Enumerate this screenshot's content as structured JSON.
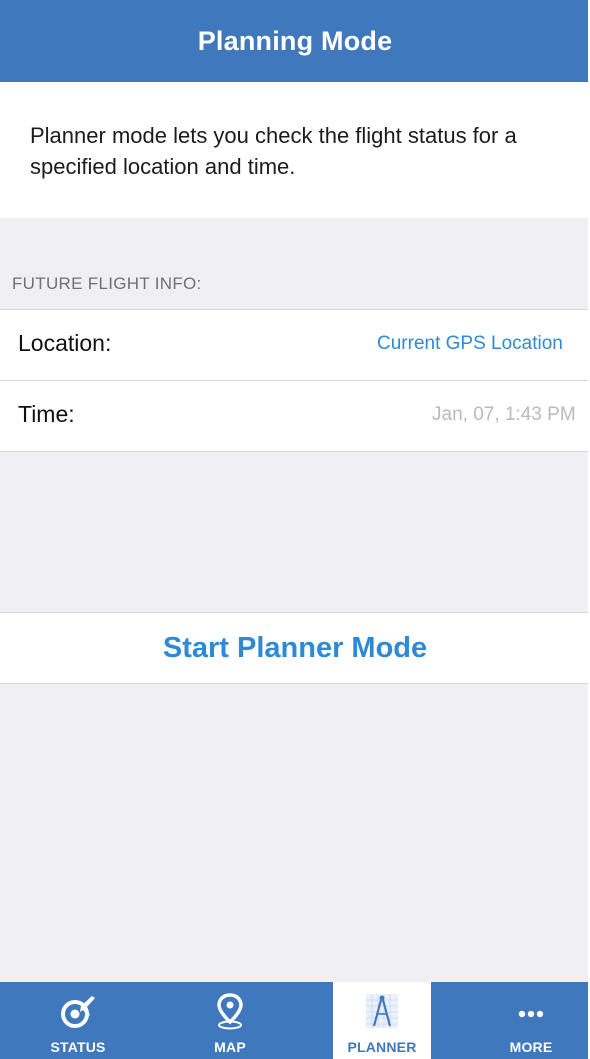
{
  "header": {
    "title": "Planning Mode"
  },
  "intro": {
    "text": "Planner mode lets you check the flight status for a specified location and time."
  },
  "future_flight": {
    "section_label": "FUTURE FLIGHT INFO:",
    "location": {
      "label": "Location:",
      "value": "Current GPS Location"
    },
    "time": {
      "label": "Time:",
      "value": "Jan, 07, 1:43 PM"
    }
  },
  "actions": {
    "start_label": "Start Planner Mode"
  },
  "tabbar": {
    "active": "PLANNER",
    "tabs": [
      {
        "label": "STATUS",
        "icon": "status-airplane-icon"
      },
      {
        "label": "MAP",
        "icon": "map-pin-icon"
      },
      {
        "label": "PLANNER",
        "icon": "compass-drafting-icon"
      },
      {
        "label": "MORE",
        "icon": "more-dots-icon"
      }
    ]
  },
  "colors": {
    "header_blue": "#3f78bd",
    "link_blue": "#2e8ad6",
    "background": "#efeff4"
  }
}
